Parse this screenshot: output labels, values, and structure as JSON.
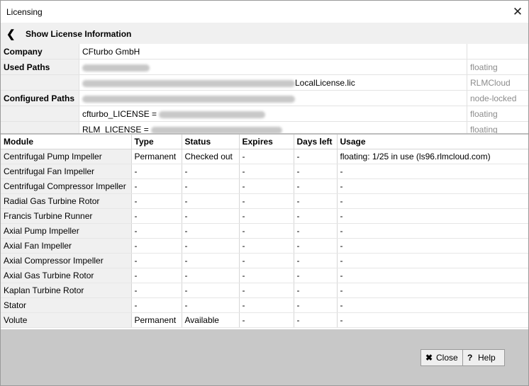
{
  "window": {
    "title": "Licensing",
    "close_glyph": "✕"
  },
  "header": {
    "back_glyph": "❮",
    "title": "Show License Information"
  },
  "info": {
    "company": {
      "label": "Company",
      "value": "CFturbo GmbH"
    },
    "used_paths": {
      "label": "Used Paths",
      "rows": [
        {
          "value": "",
          "type": "floating"
        },
        {
          "value": "LocalLicense.lic",
          "type": "RLMCloud"
        }
      ]
    },
    "configured_paths": {
      "label": "Configured Paths",
      "rows": [
        {
          "value": "",
          "type": "node-locked"
        },
        {
          "value": "cfturbo_LICENSE =",
          "type": "floating"
        },
        {
          "value": "RLM_LICENSE =",
          "type": "floating"
        }
      ]
    }
  },
  "modules": {
    "columns": [
      "Module",
      "Type",
      "Status",
      "Expires",
      "Days left",
      "Usage"
    ],
    "rows": [
      [
        "Centrifugal Pump Impeller",
        "Permanent",
        "Checked out",
        "-",
        "-",
        "floating: 1/25 in use (ls96.rlmcloud.com)"
      ],
      [
        "Centrifugal Fan Impeller",
        "-",
        "-",
        "-",
        "-",
        "-"
      ],
      [
        "Centrifugal Compressor Impeller",
        "-",
        "-",
        "-",
        "-",
        "-"
      ],
      [
        "Radial Gas Turbine Rotor",
        "-",
        "-",
        "-",
        "-",
        "-"
      ],
      [
        "Francis Turbine Runner",
        "-",
        "-",
        "-",
        "-",
        "-"
      ],
      [
        "Axial Pump Impeller",
        "-",
        "-",
        "-",
        "-",
        "-"
      ],
      [
        "Axial Fan Impeller",
        "-",
        "-",
        "-",
        "-",
        "-"
      ],
      [
        "Axial Compressor Impeller",
        "-",
        "-",
        "-",
        "-",
        "-"
      ],
      [
        "Axial Gas Turbine Rotor",
        "-",
        "-",
        "-",
        "-",
        "-"
      ],
      [
        "Kaplan Turbine Rotor",
        "-",
        "-",
        "-",
        "-",
        "-"
      ],
      [
        "Stator",
        "-",
        "-",
        "-",
        "-",
        "-"
      ],
      [
        "Volute",
        "Permanent",
        "Available",
        "-",
        "-",
        "-"
      ]
    ]
  },
  "footer": {
    "close_button": {
      "icon": "✖",
      "label": "Close"
    },
    "help_button": {
      "icon": "?",
      "label": "Help"
    }
  }
}
